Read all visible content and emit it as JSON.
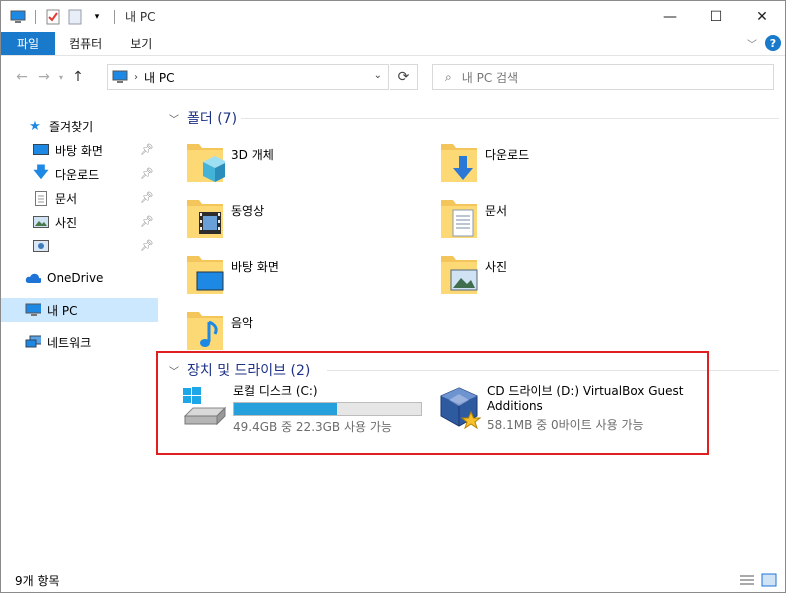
{
  "window": {
    "title": "내 PC"
  },
  "ribbon": {
    "tabs": [
      "파일",
      "컴퓨터",
      "보기"
    ],
    "help_label": "?"
  },
  "address": {
    "path": "내 PC",
    "search_placeholder": "내 PC 검색"
  },
  "nav": {
    "quick_access": "즐겨찾기",
    "items": [
      {
        "label": "바탕 화면",
        "icon": "desktop-icon",
        "pinned": true
      },
      {
        "label": "다운로드",
        "icon": "download-icon",
        "pinned": true
      },
      {
        "label": "문서",
        "icon": "document-icon",
        "pinned": true
      },
      {
        "label": "사진",
        "icon": "pictures-icon",
        "pinned": true
      },
      {
        "label": "",
        "icon": "screenshot-icon",
        "pinned": true
      }
    ],
    "onedrive": "OneDrive",
    "this_pc": "내 PC",
    "network": "네트워크"
  },
  "folders": {
    "header": "폴더 (7)",
    "items": [
      {
        "label": "3D 개체",
        "icon": "3d-objects-icon"
      },
      {
        "label": "다운로드",
        "icon": "downloads-folder-icon"
      },
      {
        "label": "동영상",
        "icon": "videos-folder-icon"
      },
      {
        "label": "문서",
        "icon": "documents-folder-icon"
      },
      {
        "label": "바탕 화면",
        "icon": "desktop-folder-icon"
      },
      {
        "label": "사진",
        "icon": "pictures-folder-icon"
      },
      {
        "label": "음악",
        "icon": "music-folder-icon"
      }
    ]
  },
  "drives": {
    "header": "장치 및 드라이브 (2)",
    "items": [
      {
        "name": "로컬 디스크 (C:)",
        "free": "49.4GB 중 22.3GB 사용 가능",
        "used_fraction": 0.55,
        "icon": "windows-drive-icon"
      },
      {
        "name": "CD 드라이브 (D:) VirtualBox Guest",
        "name2": "Additions",
        "free": "58.1MB 중 0바이트 사용 가능",
        "icon": "virtualbox-cd-icon"
      }
    ]
  },
  "status": {
    "count": "9개 항목"
  },
  "colors": {
    "accent": "#1979ca",
    "group_header": "#1e3287",
    "highlight_box": "#e02020",
    "drive_bar": "#26a0da"
  }
}
